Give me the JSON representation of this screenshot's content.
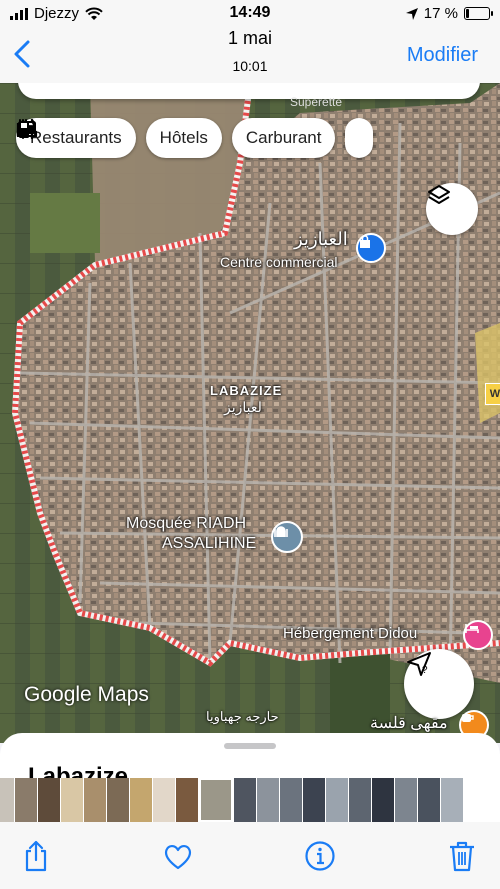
{
  "status_bar": {
    "carrier": "Djezzy",
    "time": "14:49",
    "battery": "17 %"
  },
  "nav": {
    "date": "1 mai",
    "time": "10:01",
    "modify_label": "Modifier"
  },
  "map": {
    "top_label": "Superette",
    "chips": [
      {
        "label": "Restaurants",
        "icon": "fork-knife-icon"
      },
      {
        "label": "Hôtels",
        "icon": "bed-icon"
      },
      {
        "label": "Carburant",
        "icon": "fuel-pump-icon"
      }
    ],
    "labels": {
      "mall_ar": "العبازيز",
      "mall": "Centre commercial",
      "town": "LABAZIZE",
      "town_ar": "لعبازيز",
      "mosque_line1": "Mosquée RIADH",
      "mosque_line2": "ASSALIHINE",
      "hotel": "Hébergement Didou",
      "cafe_ar": "مقهى قلسة",
      "street_ar": "حارجه جهباويا",
      "road_sign": "W"
    },
    "attribution": "Google Maps",
    "colors": {
      "mall_pin": "#1a73e8",
      "mosque_pin": "#6d8fa8",
      "hotel_pin": "#e8438f",
      "cafe_pin": "#f28a1c",
      "boundary": "#e54a4a"
    }
  },
  "sheet": {
    "title": "Labazize"
  },
  "toolbar": {
    "share": "share-icon",
    "favorite": "heart-icon",
    "info": "info-icon",
    "delete": "trash-icon",
    "accent": "#1a7cf5"
  }
}
